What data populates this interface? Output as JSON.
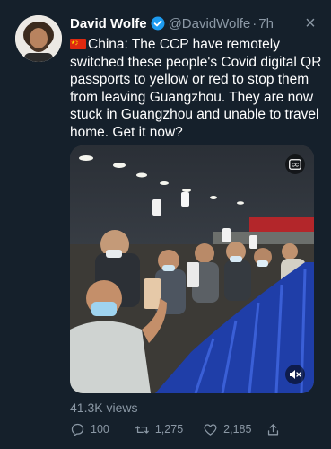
{
  "tweet": {
    "author_name": "David Wolfe",
    "handle": "@DavidWolfe",
    "separator": "·",
    "time": "7h",
    "text": "China: The CCP have remotely switched these people's Covid digital QR passports to yellow or red to stop them from leaving Guangzhou. They are now stuck in Guangzhou and unable to travel home. Get it now?",
    "views": "41.3K views",
    "actions": {
      "replies": "100",
      "retweets": "1,275",
      "likes": "2,185"
    }
  },
  "icons": {
    "verified": "verified-badge-icon",
    "flag": "china-flag-icon",
    "close": "close-icon",
    "caption": "closed-captions-icon",
    "mute": "speaker-muted-icon",
    "reply": "reply-icon",
    "retweet": "retweet-icon",
    "like": "heart-icon",
    "share": "share-icon"
  },
  "colors": {
    "background": "#15202b",
    "text": "#ffffff",
    "muted": "#8b98a5",
    "verified": "#1d9bf0"
  }
}
